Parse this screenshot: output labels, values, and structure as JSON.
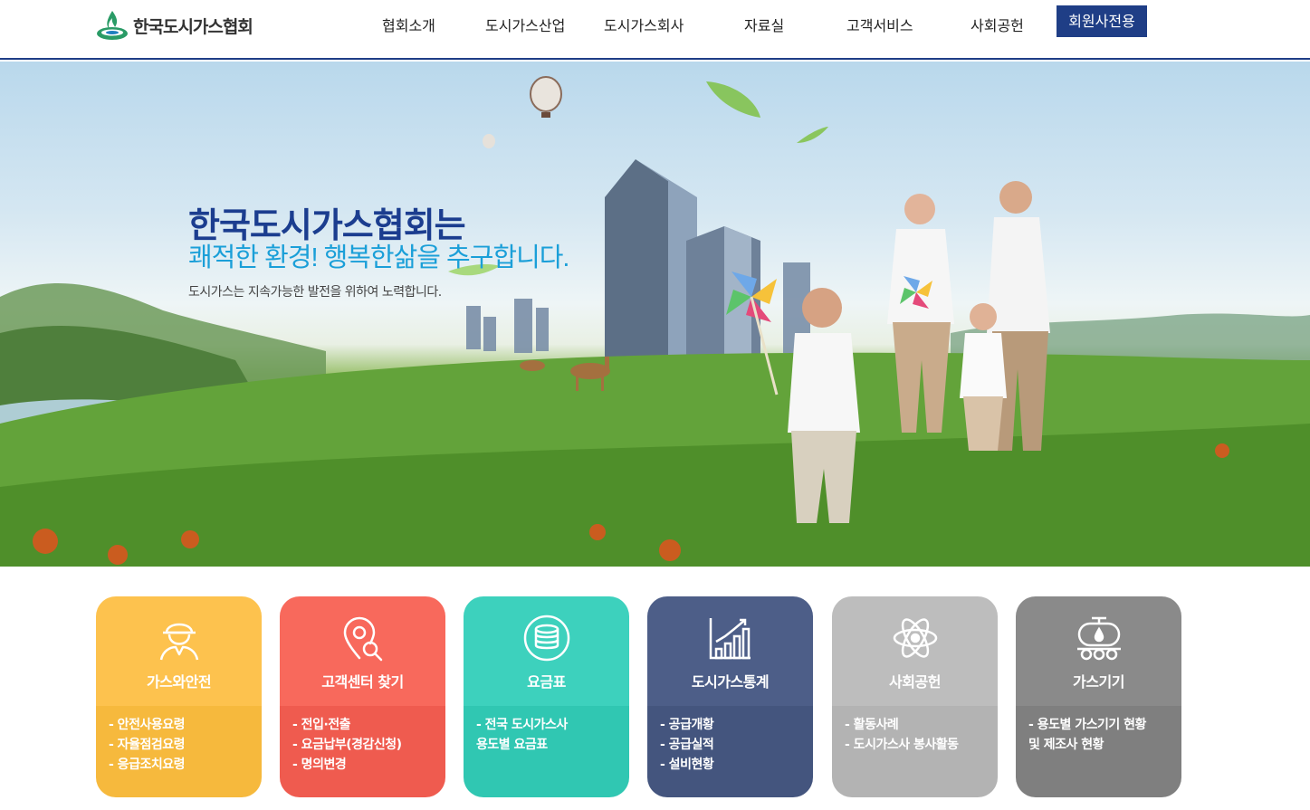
{
  "header": {
    "logo_text": "한국도시가스협회",
    "nav": [
      "협회소개",
      "도시가스산업",
      "도시가스회사",
      "자료실",
      "고객서비스",
      "사회공헌"
    ],
    "member_button": "회원사전용"
  },
  "hero": {
    "title": "한국도시가스협회는",
    "subtitle": "쾌적한 환경! 행복한삶을 추구합니다.",
    "description": "도시가스는 지속가능한 발전을 위하여 노력합니다."
  },
  "cards": [
    {
      "title": "가스와안전",
      "icon": "worker-helmet-icon",
      "color_top": "#fdc24e",
      "color_bottom": "#f6b93d",
      "links": [
        "- 안전사용요령",
        "- 자율점검요령",
        "- 응급조치요령"
      ]
    },
    {
      "title": "고객센터 찾기",
      "icon": "location-search-icon",
      "color_top": "#f8695c",
      "color_bottom": "#ef5b4f",
      "links": [
        "- 전입·전출",
        "- 요금납부(경감신청)",
        "- 명의변경"
      ]
    },
    {
      "title": "요금표",
      "icon": "coin-stack-icon",
      "color_top": "#3dd1bd",
      "color_bottom": "#30c7b2",
      "links": [
        "- 전국 도시가스사",
        "용도별 요금표"
      ]
    },
    {
      "title": "도시가스통계",
      "icon": "bar-chart-icon",
      "color_top": "#4d5e88",
      "color_bottom": "#44557e",
      "links": [
        "- 공급개황",
        "- 공급실적",
        "- 설비현황"
      ]
    },
    {
      "title": "사회공헌",
      "icon": "atom-icon",
      "color_top": "#bdbdbd",
      "color_bottom": "#b3b3b3",
      "links": [
        "- 활동사례",
        "- 도시가스사 봉사활동"
      ]
    },
    {
      "title": "가스기기",
      "icon": "gas-tank-truck-icon",
      "color_top": "#8a8a8a",
      "color_bottom": "#7f7f7f",
      "links": [
        "- 용도별 가스기기 현황",
        "및 제조사 현황"
      ]
    }
  ]
}
